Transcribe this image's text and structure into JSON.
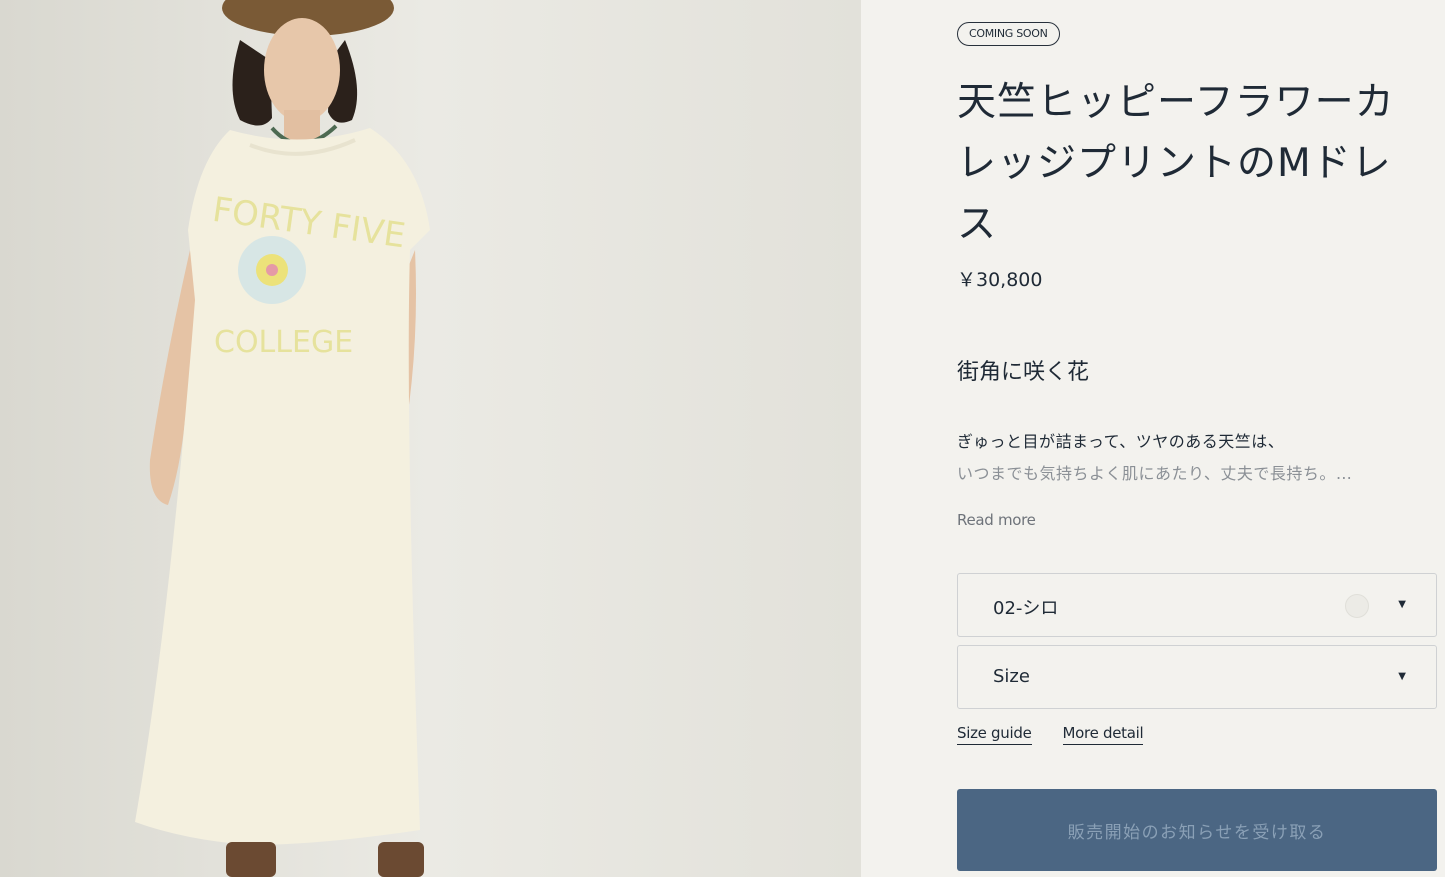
{
  "product": {
    "badge": "COMING SOON",
    "title": "天竺ヒッピーフラワーカレッジプリントのMドレス",
    "price": "￥30,800",
    "subheading": "街角に咲く花",
    "description_line1": "ぎゅっと目が詰まって、ツヤのある天竺は、",
    "description_line2": "いつまでも気持ちよく肌にあたり、丈夫で長持ち。…",
    "read_more": "Read more"
  },
  "options": {
    "color_value": "02-シロ",
    "size_value": "Size",
    "swatch_color": "#ecebe6"
  },
  "links": {
    "size_guide": "Size guide",
    "more_detail": "More detail"
  },
  "cta": {
    "label": "販売開始のお知らせを受け取る",
    "background": "#4b6683"
  },
  "photo": {
    "print_text_top": "FORTY FIVE",
    "print_text_bottom": "COLLEGE"
  }
}
